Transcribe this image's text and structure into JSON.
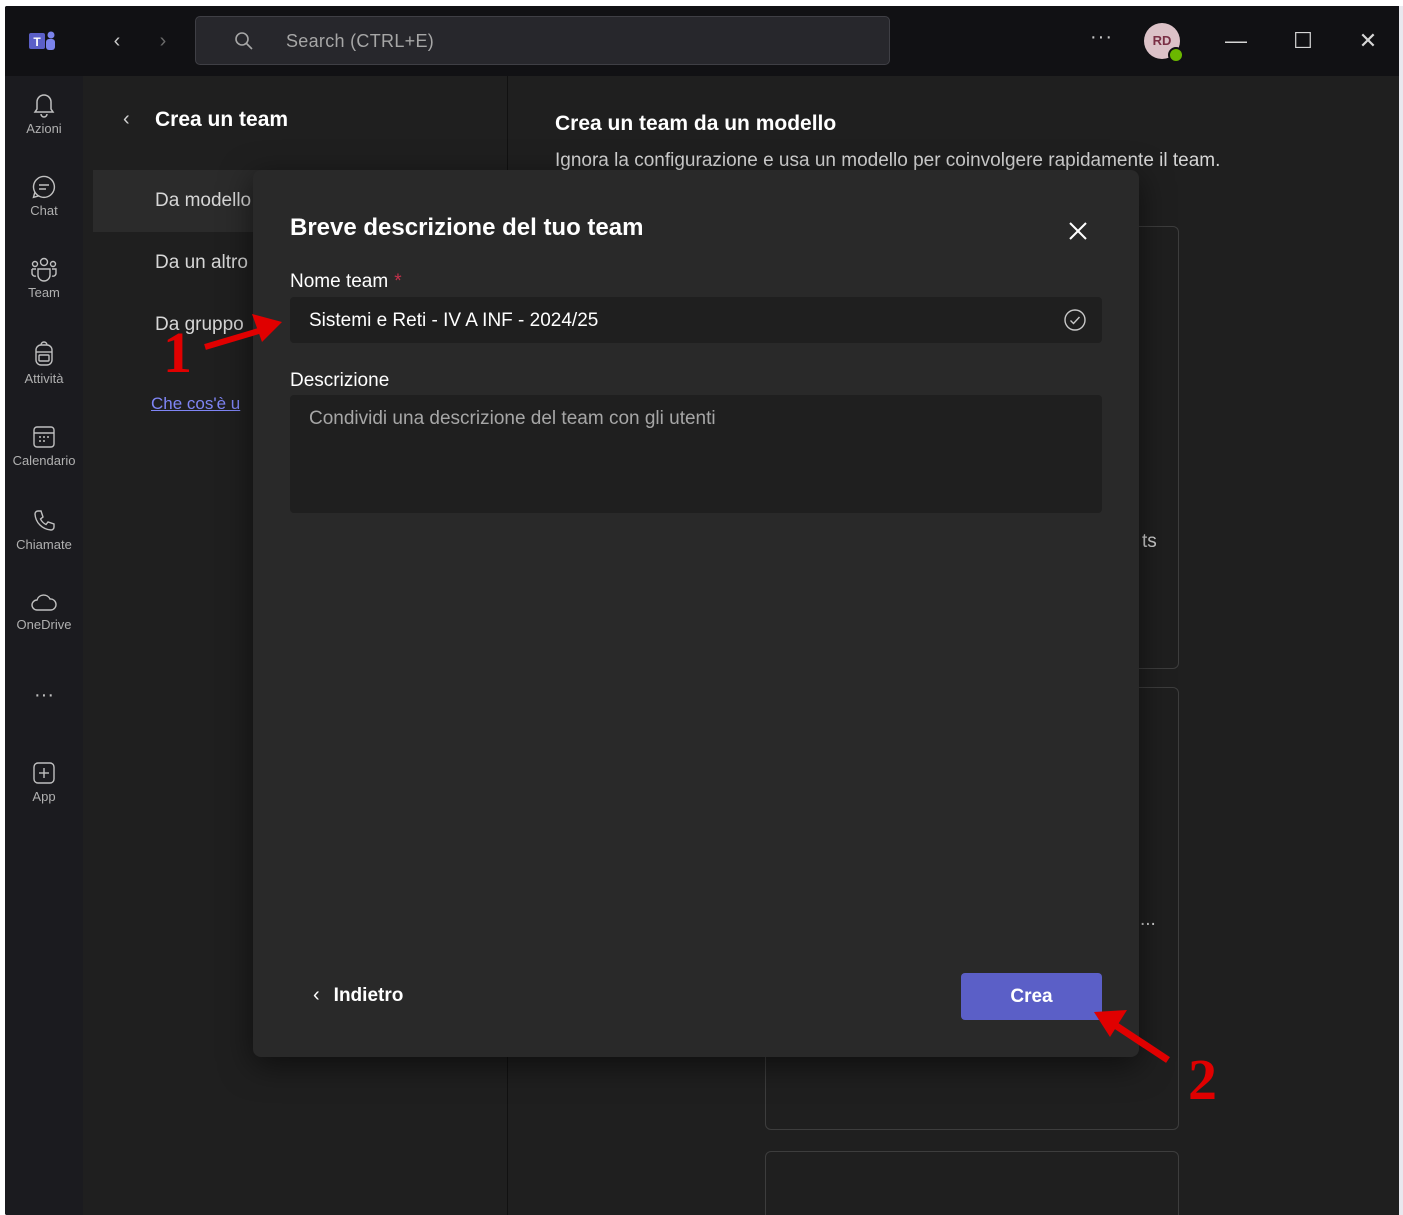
{
  "titlebar": {
    "search_placeholder": "Search (CTRL+E)",
    "more_label": "···",
    "avatar_initials": "RD",
    "minimize": "—",
    "maximize": "☐",
    "close": "✕"
  },
  "rail": {
    "items": [
      {
        "label": "Azioni",
        "icon": "bell-icon"
      },
      {
        "label": "Chat",
        "icon": "chat-icon"
      },
      {
        "label": "Team",
        "icon": "team-icon"
      },
      {
        "label": "Attività",
        "icon": "backpack-icon"
      },
      {
        "label": "Calendario",
        "icon": "calendar-icon"
      },
      {
        "label": "Chiamate",
        "icon": "phone-icon"
      },
      {
        "label": "OneDrive",
        "icon": "cloud-icon"
      },
      {
        "label": "App",
        "icon": "add-app-icon"
      }
    ],
    "more_label": "···"
  },
  "left_pane": {
    "back_label": "‹",
    "title": "Crea un team",
    "items": [
      "Da modello",
      "Da un altro",
      "Da gruppo"
    ],
    "link": "Che cos'è u"
  },
  "content": {
    "title": "Crea un team da un modello",
    "subtitle": "Ignora la configurazione e usa un modello per coinvolgere rapidamente il team.",
    "card_fragment_1": "ts",
    "card_fragment_2": "..."
  },
  "dialog": {
    "title": "Breve descrizione del tuo team",
    "name_label": "Nome team",
    "required_mark": "*",
    "name_value": "Sistemi e Reti - IV A INF - 2024/25",
    "desc_label": "Descrizione",
    "desc_placeholder": "Condividi una descrizione del team con gli utenti",
    "back_button": "Indietro",
    "create_button": "Crea"
  },
  "annotations": {
    "step1": "1",
    "step2": "2",
    "color": "#e00000"
  },
  "colors": {
    "accent": "#5b5fc7",
    "background": "#1f1f1f",
    "dialog": "#292929"
  }
}
